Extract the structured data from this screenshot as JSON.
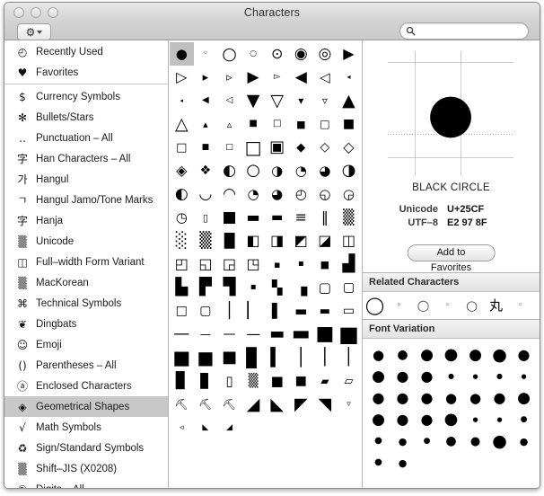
{
  "window": {
    "title": "Characters",
    "traffic_lights": [
      "close",
      "minimize",
      "zoom"
    ]
  },
  "toolbar": {
    "gear_glyph": "⚙",
    "gear_label": "action-menu"
  },
  "search": {
    "value": "",
    "placeholder": ""
  },
  "sidebar": {
    "groups": [
      {
        "items": [
          {
            "icon": "◴",
            "label": "Recently Used",
            "selected": false
          },
          {
            "icon": "♥",
            "label": "Favorites",
            "selected": false
          }
        ]
      },
      {
        "items": [
          {
            "icon": "$",
            "label": "Currency Symbols",
            "selected": false
          },
          {
            "icon": "✻",
            "label": "Bullets/Stars",
            "selected": false
          },
          {
            "icon": "‥",
            "label": "Punctuation – All",
            "selected": false
          },
          {
            "icon": "字",
            "label": "Han Characters – All",
            "selected": false
          },
          {
            "icon": "가",
            "label": "Hangul",
            "selected": false
          },
          {
            "icon": "ㄱ",
            "label": "Hangul Jamo/Tone Marks",
            "selected": false
          },
          {
            "icon": "字",
            "label": "Hanja",
            "selected": false
          },
          {
            "icon": "▒",
            "label": "Unicode",
            "selected": false
          },
          {
            "icon": "◫",
            "label": "Full–width Form Variant",
            "selected": false
          },
          {
            "icon": "▒",
            "label": "MacKorean",
            "selected": false
          },
          {
            "icon": "⌘",
            "label": "Technical Symbols",
            "selected": false
          },
          {
            "icon": "❦",
            "label": "Dingbats",
            "selected": false
          },
          {
            "icon": "☺",
            "label": "Emoji",
            "selected": false
          },
          {
            "icon": "()",
            "label": "Parentheses – All",
            "selected": false
          },
          {
            "icon": "ⓐ",
            "label": "Enclosed Characters",
            "selected": false
          },
          {
            "icon": "◈",
            "label": "Geometrical Shapes",
            "selected": true
          },
          {
            "icon": "√",
            "label": "Math Symbols",
            "selected": false
          },
          {
            "icon": "♻",
            "label": "Sign/Standard Symbols",
            "selected": false
          },
          {
            "icon": "▒",
            "label": "Shift–JIS (X0208)",
            "selected": false
          },
          {
            "icon": "①",
            "label": "Digits – All",
            "selected": false
          }
        ]
      }
    ]
  },
  "grid": {
    "selected_index": 0,
    "cells": [
      {
        "ch": "●",
        "size": 15
      },
      {
        "ch": "◦",
        "size": 10
      },
      {
        "ch": "○",
        "size": 19
      },
      {
        "ch": "○",
        "size": 9
      },
      {
        "ch": "⊙",
        "size": 16
      },
      {
        "ch": "◉",
        "size": 17
      },
      {
        "ch": "◎",
        "size": 17
      },
      {
        "ch": "▶",
        "size": 16
      },
      {
        "ch": "▷",
        "size": 16
      },
      {
        "ch": "▸",
        "size": 13
      },
      {
        "ch": "▹",
        "size": 13
      },
      {
        "ch": "▶",
        "size": 17
      },
      {
        "ch": "▻",
        "size": 10
      },
      {
        "ch": "◀",
        "size": 17
      },
      {
        "ch": "◁",
        "size": 15
      },
      {
        "ch": "◂",
        "size": 8
      },
      {
        "ch": "◂",
        "size": 7
      },
      {
        "ch": "◀",
        "size": 10
      },
      {
        "ch": "◁",
        "size": 10
      },
      {
        "ch": "▼",
        "size": 19
      },
      {
        "ch": "▽",
        "size": 19
      },
      {
        "ch": "▾",
        "size": 12
      },
      {
        "ch": "▿",
        "size": 12
      },
      {
        "ch": "▲",
        "size": 19
      },
      {
        "ch": "△",
        "size": 19
      },
      {
        "ch": "▴",
        "size": 11
      },
      {
        "ch": "▵",
        "size": 11
      },
      {
        "ch": "■",
        "size": 10
      },
      {
        "ch": "□",
        "size": 10
      },
      {
        "ch": "■",
        "size": 11
      },
      {
        "ch": "□",
        "size": 12
      },
      {
        "ch": "■",
        "size": 14
      },
      {
        "ch": "□",
        "size": 13
      },
      {
        "ch": "■",
        "size": 9
      },
      {
        "ch": "□",
        "size": 9
      },
      {
        "ch": "□",
        "size": 20
      },
      {
        "ch": "▣",
        "size": 18
      },
      {
        "ch": "◆",
        "size": 13
      },
      {
        "ch": "◇",
        "size": 14
      },
      {
        "ch": "◇",
        "size": 16
      },
      {
        "ch": "◈",
        "size": 16
      },
      {
        "ch": "❖",
        "size": 14
      },
      {
        "ch": "◐",
        "size": 17
      },
      {
        "ch": "○",
        "size": 18
      },
      {
        "ch": "◑",
        "size": 15
      },
      {
        "ch": "◔",
        "size": 15
      },
      {
        "ch": "◕",
        "size": 15
      },
      {
        "ch": "◑",
        "size": 18
      },
      {
        "ch": "◐",
        "size": 17
      },
      {
        "ch": "◡",
        "size": 17
      },
      {
        "ch": "◠",
        "size": 17
      },
      {
        "ch": "◔",
        "size": 15
      },
      {
        "ch": "◕",
        "size": 15
      },
      {
        "ch": "◴",
        "size": 15
      },
      {
        "ch": "◵",
        "size": 15
      },
      {
        "ch": "◶",
        "size": 15
      },
      {
        "ch": "◷",
        "size": 15
      },
      {
        "ch": "▯",
        "size": 11
      },
      {
        "ch": "■",
        "size": 17
      },
      {
        "ch": "▬",
        "size": 16
      },
      {
        "ch": "▬",
        "size": 14
      },
      {
        "ch": "≡",
        "size": 16
      },
      {
        "ch": "‖",
        "size": 16
      },
      {
        "ch": "▒",
        "size": 16
      },
      {
        "ch": "░",
        "size": 17
      },
      {
        "ch": "▒",
        "size": 17
      },
      {
        "ch": "█",
        "size": 15
      },
      {
        "ch": "◧",
        "size": 16
      },
      {
        "ch": "◨",
        "size": 16
      },
      {
        "ch": "◩",
        "size": 16
      },
      {
        "ch": "◪",
        "size": 16
      },
      {
        "ch": "◫",
        "size": 16
      },
      {
        "ch": "◰",
        "size": 16
      },
      {
        "ch": "◱",
        "size": 16
      },
      {
        "ch": "◲",
        "size": 16
      },
      {
        "ch": "◳",
        "size": 16
      },
      {
        "ch": "▪",
        "size": 11
      },
      {
        "ch": "▪",
        "size": 10
      },
      {
        "ch": "■",
        "size": 11
      },
      {
        "ch": "▟",
        "size": 18
      },
      {
        "ch": "▙",
        "size": 18
      },
      {
        "ch": "▛",
        "size": 18
      },
      {
        "ch": "▜",
        "size": 18
      },
      {
        "ch": "▪",
        "size": 10
      },
      {
        "ch": "▚",
        "size": 15
      },
      {
        "ch": "▗",
        "size": 18
      },
      {
        "ch": "▢",
        "size": 15
      },
      {
        "ch": "▢",
        "size": 14
      },
      {
        "ch": "□",
        "size": 14
      },
      {
        "ch": "▢",
        "size": 14
      },
      {
        "ch": "│",
        "size": 17
      },
      {
        "ch": "▏",
        "size": 17
      },
      {
        "ch": "▌",
        "size": 15
      },
      {
        "ch": "▬",
        "size": 15
      },
      {
        "ch": "▬",
        "size": 13
      },
      {
        "ch": "▭",
        "size": 14
      },
      {
        "ch": "—",
        "size": 18
      },
      {
        "ch": "—",
        "size": 12
      },
      {
        "ch": "—",
        "size": 14
      },
      {
        "ch": "—",
        "size": 16
      },
      {
        "ch": "▬",
        "size": 18
      },
      {
        "ch": "▬",
        "size": 22
      },
      {
        "ch": "■",
        "size": 22
      },
      {
        "ch": "■",
        "size": 24
      },
      {
        "ch": "■",
        "size": 21
      },
      {
        "ch": "■",
        "size": 20
      },
      {
        "ch": "■",
        "size": 18
      },
      {
        "ch": "▊",
        "size": 20
      },
      {
        "ch": "▍",
        "size": 19
      },
      {
        "ch": "│",
        "size": 19
      },
      {
        "ch": "│",
        "size": 18
      },
      {
        "ch": "│",
        "size": 18
      },
      {
        "ch": "▊",
        "size": 17
      },
      {
        "ch": "▊",
        "size": 15
      },
      {
        "ch": "▯",
        "size": 15
      },
      {
        "ch": "▒",
        "size": 14
      },
      {
        "ch": "■",
        "size": 15
      },
      {
        "ch": "■",
        "size": 14
      },
      {
        "ch": "▰",
        "size": 12
      },
      {
        "ch": "▱",
        "size": 13
      },
      {
        "ch": "⛏",
        "size": 12
      },
      {
        "ch": "⛏",
        "size": 12
      },
      {
        "ch": "⛏",
        "size": 12
      },
      {
        "ch": "◢",
        "size": 19
      },
      {
        "ch": "◣",
        "size": 19
      },
      {
        "ch": "◤",
        "size": 19
      },
      {
        "ch": "◥",
        "size": 19
      },
      {
        "ch": "▿",
        "size": 9
      },
      {
        "ch": "◃",
        "size": 9
      },
      {
        "ch": "◣",
        "size": 9
      },
      {
        "ch": "◢",
        "size": 9
      }
    ]
  },
  "detail": {
    "glyph": "●",
    "char_name": "BLACK CIRCLE",
    "unicode_label": "Unicode",
    "unicode_value": "U+25CF",
    "utf8_label": "UTF–8",
    "utf8_value": "E2 97 8F",
    "add_favorites_label": "Add to Favorites"
  },
  "related": {
    "header": "Related Characters",
    "items": [
      {
        "ch": "◯",
        "size": 19,
        "color": "#000000"
      },
      {
        "ch": "◦",
        "size": 9,
        "color": "#000000"
      },
      {
        "ch": "○",
        "size": 16,
        "color": "#555555"
      },
      {
        "ch": "◦",
        "size": 9,
        "color": "#333333"
      },
      {
        "ch": "○",
        "size": 15,
        "color": "#444444"
      },
      {
        "ch": "丸",
        "size": 15,
        "color": "#000000"
      },
      {
        "ch": "◦",
        "size": 9,
        "color": "#333333"
      }
    ]
  },
  "font_variation": {
    "header": "Font Variation",
    "glyph": "●",
    "columns": 7,
    "sizes": [
      [
        15,
        14,
        17,
        18,
        17,
        19,
        16
      ],
      [
        17,
        16,
        16,
        8,
        7,
        8,
        7
      ],
      [
        16,
        16,
        16,
        15,
        15,
        16,
        17
      ],
      [
        17,
        16,
        16,
        18,
        7,
        7,
        9
      ],
      [
        10,
        11,
        9,
        14,
        13,
        19,
        11
      ],
      [
        10,
        11,
        0,
        0,
        0,
        0,
        0
      ]
    ]
  }
}
